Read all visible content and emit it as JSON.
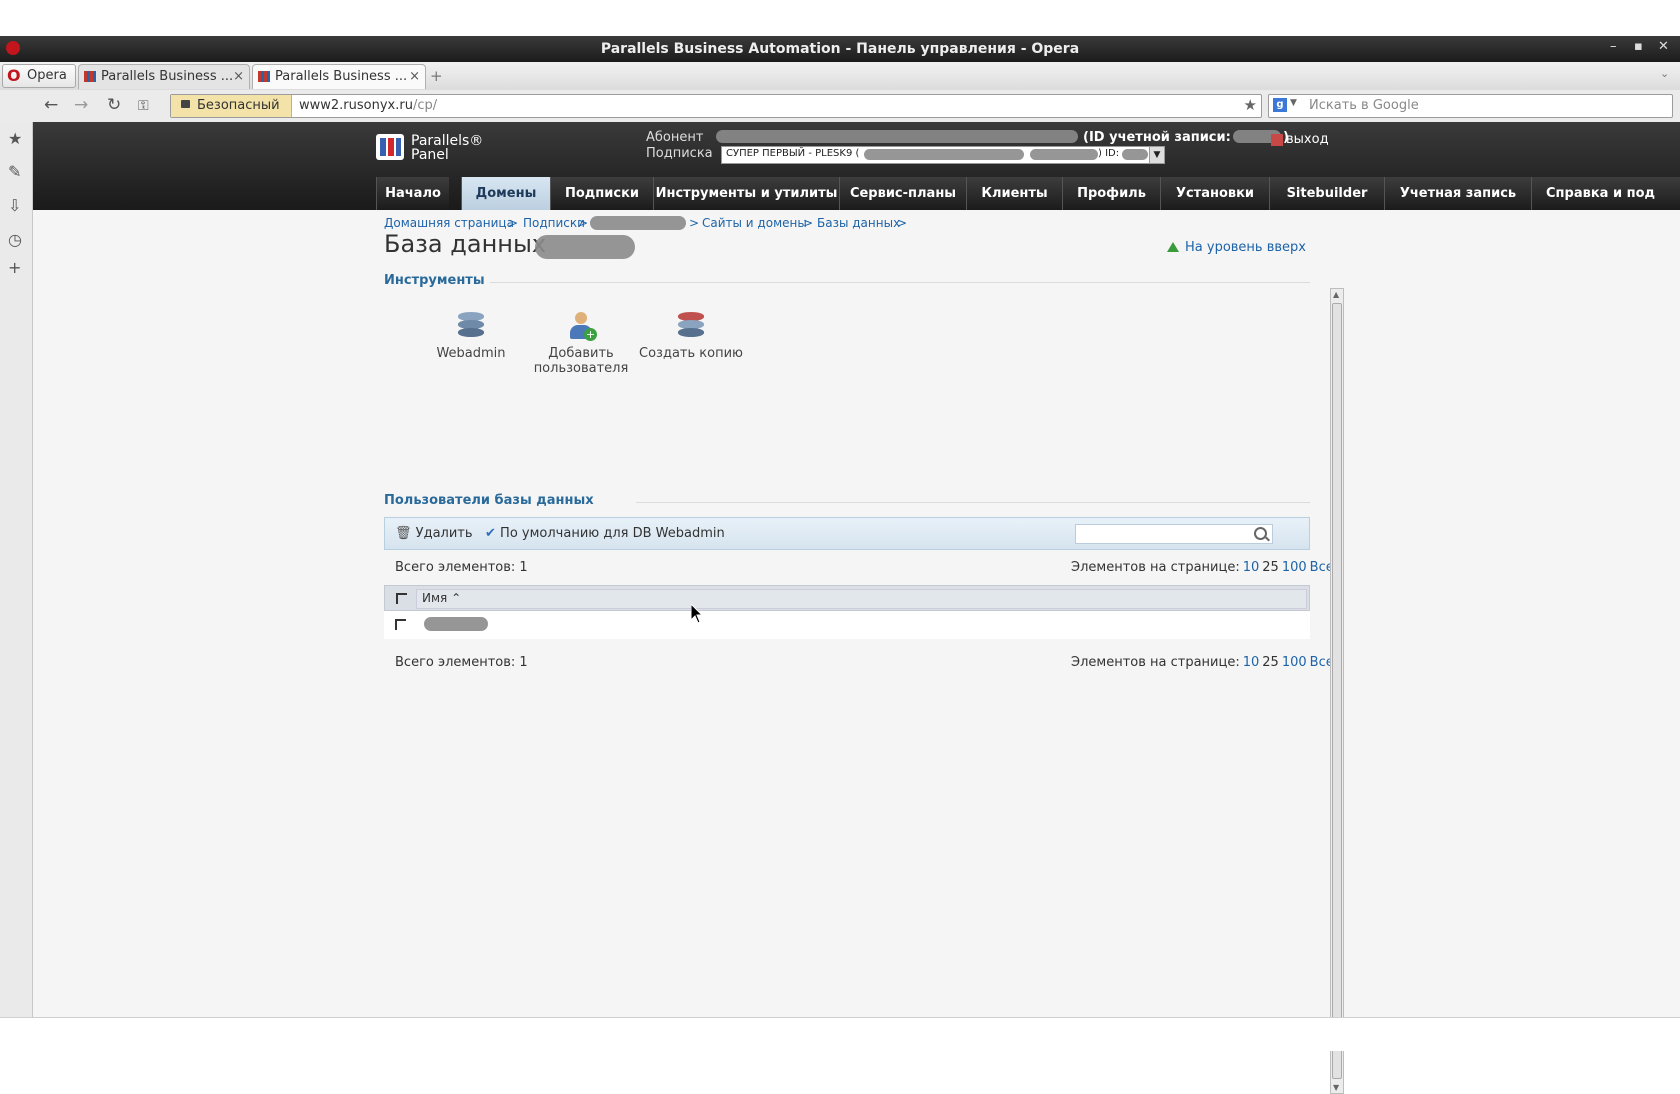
{
  "window": {
    "title": "Parallels Business Automation - Панель управления - Opera",
    "controls": [
      "–",
      "▪",
      "✕"
    ]
  },
  "tabs": {
    "opera_label": "Opera",
    "items": [
      {
        "label": "Parallels Business ...",
        "active": false
      },
      {
        "label": "Parallels Business ...",
        "active": true
      }
    ],
    "new_tab": "+"
  },
  "addressbar": {
    "security_label": "Безопасный",
    "url_host": "www2.rusonyx.ru",
    "url_path": "/cp/",
    "search_placeholder": "Искать в Google"
  },
  "header": {
    "logo_line1": "Parallels®",
    "logo_line2": "Panel",
    "subscriber_label": "Абонент",
    "account_id_label": "(ID учетной записи:",
    "account_id_close": ")",
    "subscription_label": "Подписка",
    "subscription_value": "СУПЕР ПЕРВЫЙ - PLESK9 (",
    "subscription_id_label": ") ID:",
    "logout_label": "выход"
  },
  "nav": {
    "items": [
      {
        "label": "Начало",
        "active": false
      },
      {
        "label": "Домены",
        "active": true
      },
      {
        "label": "Подписки",
        "active": false
      },
      {
        "label": "Инструменты и утилиты",
        "active": false
      },
      {
        "label": "Сервис-планы",
        "active": false
      },
      {
        "label": "Клиенты",
        "active": false
      },
      {
        "label": "Профиль",
        "active": false
      },
      {
        "label": "Установки",
        "active": false
      },
      {
        "label": "Sitebuilder",
        "active": false
      },
      {
        "label": "Учетная запись",
        "active": false
      },
      {
        "label": "Справка и под",
        "active": false
      }
    ]
  },
  "breadcrumb": {
    "home": "Домашняя страница",
    "subscriptions": "Подписки",
    "sites": "Сайты и домены",
    "databases": "Базы данных",
    "sep": ">"
  },
  "page": {
    "title": "База данных",
    "up_link": "На уровень вверх"
  },
  "tools": {
    "heading": "Инструменты",
    "items": [
      {
        "label_1": "Webadmin",
        "label_2": "",
        "icon": "database-icon"
      },
      {
        "label_1": "Добавить",
        "label_2": "пользователя",
        "icon": "add-user-icon"
      },
      {
        "label_1": "Создать копию",
        "label_2": "",
        "icon": "database-copy-icon"
      }
    ]
  },
  "users": {
    "heading": "Пользователи базы данных",
    "toolbar": {
      "delete_label": "Удалить",
      "default_label": "По умолчанию для DB Webadmin"
    },
    "total_label": "Всего элементов: 1",
    "per_page_label": "Элементов на странице:",
    "per_page_options": [
      "10",
      "25",
      "100",
      "Все"
    ],
    "per_page_selected": "25",
    "column_name": "Имя ⌃"
  },
  "colors": {
    "accent": "#1d63a8",
    "header_bg": "#2a2a2a",
    "active_tab": "#c8d8e8"
  }
}
